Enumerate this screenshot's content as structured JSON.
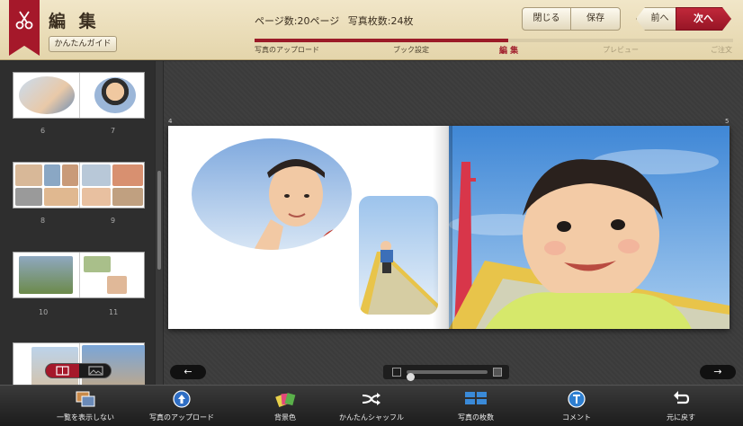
{
  "header": {
    "title": "編 集",
    "guide_label": "かんたんガイド",
    "page_count": "ページ数:20ページ",
    "photo_count": "写真枚数:24枚",
    "close_label": "閉じる",
    "save_label": "保存",
    "prev_label": "前へ",
    "next_label": "次へ",
    "progress_percent": 53,
    "steps": [
      {
        "label": "写真のアップロード",
        "state": "done"
      },
      {
        "label": "ブック設定",
        "state": "done"
      },
      {
        "label": "編 集",
        "state": "current"
      },
      {
        "label": "プレビュー",
        "state": "pending"
      },
      {
        "label": "ご注文",
        "state": "pending"
      }
    ]
  },
  "sidebar": {
    "spreads": [
      {
        "left": "6",
        "right": "7"
      },
      {
        "left": "8",
        "right": "9"
      },
      {
        "left": "10",
        "right": "11"
      }
    ]
  },
  "editor": {
    "left_page_number": "4",
    "right_page_number": "5",
    "prev_arrow": "←",
    "next_arrow": "→",
    "zoom_level": 0
  },
  "toolbar": {
    "items": [
      {
        "label": "一覧を表示しない",
        "icon": "thumbnails-icon"
      },
      {
        "label": "写真のアップロード",
        "icon": "upload-icon"
      },
      {
        "label": "背景色",
        "icon": "background-color-icon"
      },
      {
        "label": "かんたんシャッフル",
        "icon": "shuffle-icon"
      },
      {
        "label": "写真の枚数",
        "icon": "photo-count-icon"
      },
      {
        "label": "コメント",
        "icon": "comment-icon"
      },
      {
        "label": "元に戻す",
        "icon": "undo-icon"
      }
    ]
  },
  "colors": {
    "accent": "#a5182a",
    "header_bg": "#e9dcb8",
    "toolbar_bg": "#2a2a2a"
  }
}
